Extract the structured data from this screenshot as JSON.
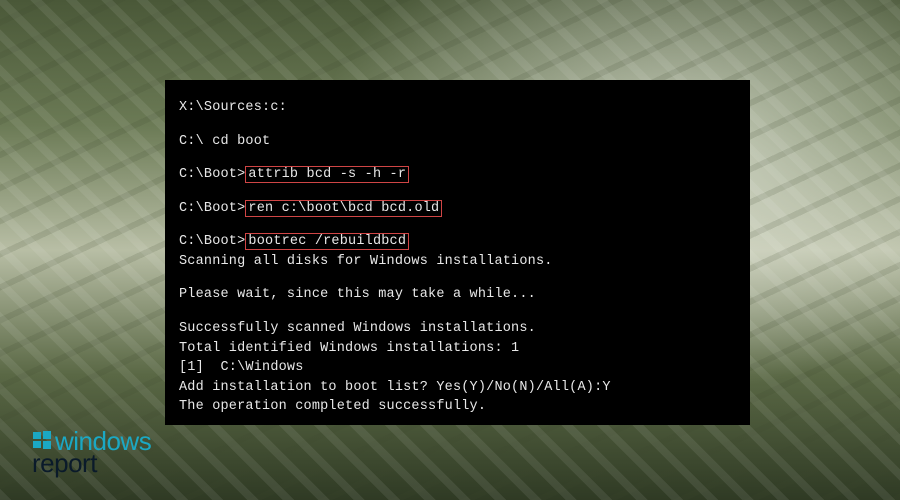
{
  "terminal": {
    "line1_prompt": "X:\\Sources:",
    "line1_cmd": "c:",
    "line2": "C:\\ cd boot",
    "line3_prompt": "C:\\Boot>",
    "line3_cmd": "attrib bcd -s -h -r",
    "line4_prompt": "C:\\Boot>",
    "line4_cmd": "ren c:\\boot\\bcd bcd.old",
    "line5_prompt": "C:\\Boot>",
    "line5_cmd": "bootrec /rebuildbcd",
    "line6": "Scanning all disks for Windows installations.",
    "line7": "Please wait, since this may take a while...",
    "line8": "Successfully scanned Windows installations.",
    "line9": "Total identified Windows installations: 1",
    "line10": "[1]  C:\\Windows",
    "line11": "Add installation to boot list? Yes(Y)/No(N)/All(A):Y",
    "line12": "The operation completed successfully."
  },
  "watermark": {
    "top": "windows",
    "bottom": "report"
  }
}
